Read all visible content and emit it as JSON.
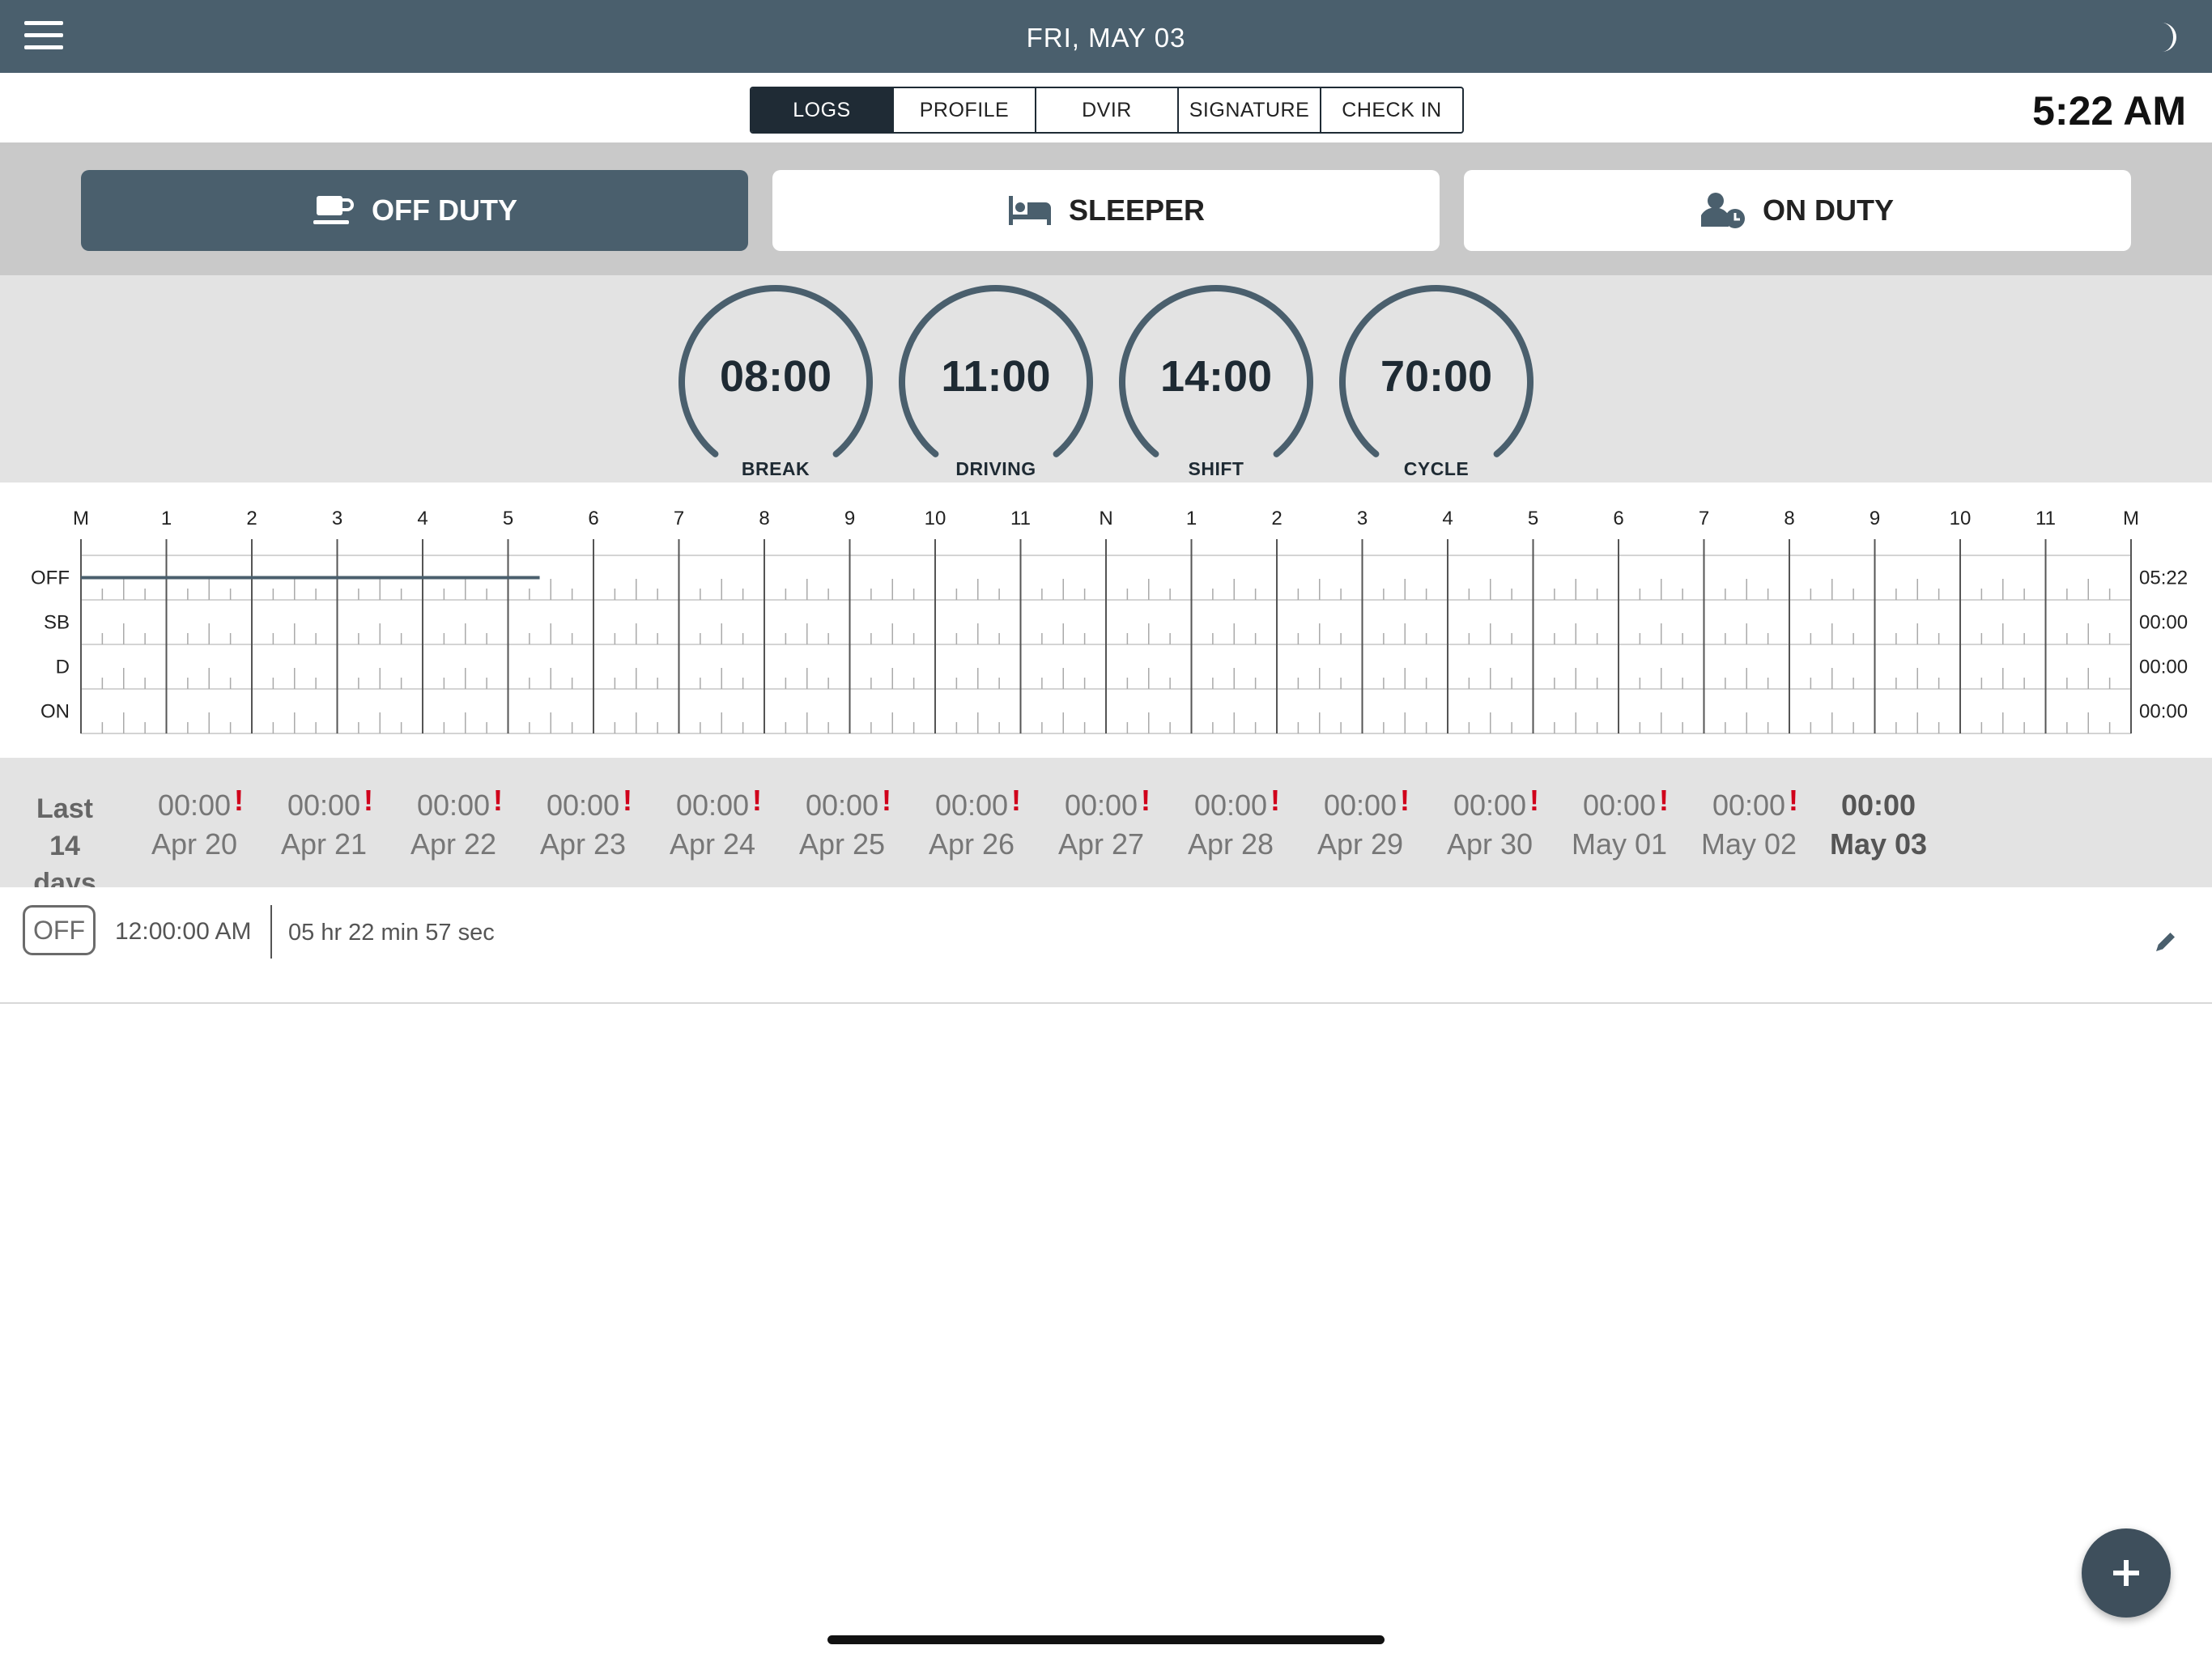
{
  "header": {
    "date": "FRI, MAY  03",
    "menu_icon": "hamburger-menu-icon",
    "theme_icon": "moon-icon"
  },
  "tabs": [
    {
      "label": "LOGS",
      "active": true
    },
    {
      "label": "PROFILE"
    },
    {
      "label": "DVIR"
    },
    {
      "label": "SIGNATURE"
    },
    {
      "label": "CHECK IN"
    }
  ],
  "clock": "5:22 AM",
  "status_buttons": {
    "off_duty": {
      "label": "OFF DUTY",
      "icon": "coffee-cup-icon",
      "active": true
    },
    "sleeper": {
      "label": "SLEEPER",
      "icon": "bed-icon"
    },
    "on_duty": {
      "label": "ON DUTY",
      "icon": "user-clock-icon"
    }
  },
  "gauges": [
    {
      "value": "08:00",
      "label": "BREAK"
    },
    {
      "value": "11:00",
      "label": "DRIVING"
    },
    {
      "value": "14:00",
      "label": "SHIFT"
    },
    {
      "value": "70:00",
      "label": "CYCLE"
    }
  ],
  "log_graph": {
    "hour_labels": [
      "M",
      "1",
      "2",
      "3",
      "4",
      "5",
      "6",
      "7",
      "8",
      "9",
      "10",
      "11",
      "N",
      "1",
      "2",
      "3",
      "4",
      "5",
      "6",
      "7",
      "8",
      "9",
      "10",
      "11",
      "M"
    ],
    "rows": [
      {
        "label": "OFF",
        "total": "05:22"
      },
      {
        "label": "SB",
        "total": "00:00"
      },
      {
        "label": "D",
        "total": "00:00"
      },
      {
        "label": "ON",
        "total": "00:00"
      }
    ],
    "segments": [
      {
        "status": "OFF",
        "start_hour": 0,
        "end_hour": 5.37
      }
    ],
    "line_color": "#4a5f6d"
  },
  "history": {
    "label_line1": "Last",
    "label_line2": "14 days",
    "days": [
      {
        "time": "00:00",
        "date": "Apr 20",
        "warning": "!"
      },
      {
        "time": "00:00",
        "date": "Apr 21",
        "warning": "!"
      },
      {
        "time": "00:00",
        "date": "Apr 22",
        "warning": "!"
      },
      {
        "time": "00:00",
        "date": "Apr 23",
        "warning": "!"
      },
      {
        "time": "00:00",
        "date": "Apr 24",
        "warning": "!"
      },
      {
        "time": "00:00",
        "date": "Apr 25",
        "warning": "!"
      },
      {
        "time": "00:00",
        "date": "Apr 26",
        "warning": "!"
      },
      {
        "time": "00:00",
        "date": "Apr 27",
        "warning": "!"
      },
      {
        "time": "00:00",
        "date": "Apr 28",
        "warning": "!"
      },
      {
        "time": "00:00",
        "date": "Apr 29",
        "warning": "!"
      },
      {
        "time": "00:00",
        "date": "Apr 30",
        "warning": "!"
      },
      {
        "time": "00:00",
        "date": "May 01",
        "warning": "!"
      },
      {
        "time": "00:00",
        "date": "May 02",
        "warning": "!"
      },
      {
        "time": "00:00",
        "date": "May 03",
        "current": true
      }
    ]
  },
  "log_entries": [
    {
      "status": "OFF",
      "time": "12:00:00 AM",
      "duration": "05 hr 22 min 57 sec",
      "edit_icon": "pencil-icon"
    }
  ],
  "fab": {
    "icon": "plus-icon"
  },
  "colors": {
    "header": "#4a5f6d",
    "tab_active": "#1f2b35",
    "warning": "#d0021b",
    "gauge_stroke": "#4a5f6d"
  }
}
